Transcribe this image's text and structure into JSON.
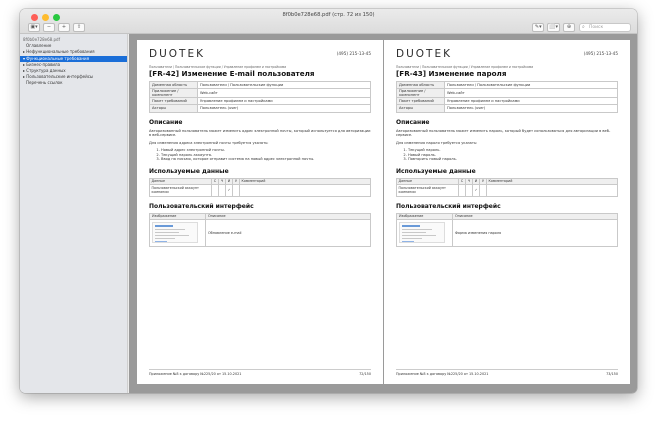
{
  "window": {
    "title": "8f0b0e728e68.pdf (стр. 72 из 150)",
    "search_placeholder": "Поиск",
    "toolbar_left": [
      "▣▾",
      "−",
      "+",
      "⇧"
    ],
    "toolbar_right": [
      "✎▾",
      "⬜▾",
      "⊕"
    ]
  },
  "sidebar": {
    "items": [
      {
        "label": "8f0b0e728e68.pdf",
        "level": "root"
      },
      {
        "label": "Оглавление",
        "level": 1
      },
      {
        "label": "▸ Нефункциональные требования",
        "level": 0
      },
      {
        "label": "▾ Функциональные требования",
        "level": 0,
        "selected": true
      },
      {
        "label": "▸ Бизнес-правила",
        "level": 0
      },
      {
        "label": "▸ Структура данных",
        "level": 0
      },
      {
        "label": "▸ Пользовательские интерфейсы",
        "level": 0
      },
      {
        "label": "Перечень ссылок",
        "level": 1
      }
    ]
  },
  "pages": [
    {
      "logo": "DUOTEK",
      "phone": "(495) 215-13-45",
      "breadcrumbs": "Пользователи / Пользовательские функции / Управление профилем и настройками",
      "title": "[FR-42] Изменение E-mail пользователя",
      "meta": [
        {
          "k": "Доменная область",
          "v": "Пользователи / Пользовательские функции"
        },
        {
          "k": "Приложение / компонент",
          "v": "Web-сайт"
        },
        {
          "k": "Пакет требований",
          "v": "Управление профилем и настройками"
        },
        {
          "k": "Акторы",
          "v": "Пользователь (user)"
        }
      ],
      "desc_heading": "Описание",
      "desc_p1": "Авторизованный пользователь может изменить адрес электронной почты, который используется для авторизации в веб-сервисе.",
      "desc_p2": "Для изменения адреса электронной почты требуется указать:",
      "steps": [
        "Новый адрес электронной почты.",
        "Текущий пароль аккаунта.",
        "Ввод на письмо, которое отправит система на новый адрес электронной почты."
      ],
      "data_heading": "Используемые данные",
      "data_cols": {
        "name": "Данные",
        "c": "С",
        "r": "Ч",
        "u": "И",
        "d": "У",
        "comment": "Комментарий"
      },
      "data_row": {
        "name": "Пользовательский аккаунт компании",
        "c": "",
        "r": "",
        "u": "✓",
        "d": "",
        "comment": ""
      },
      "ui_heading": "Пользовательский интерфейс",
      "ui_cols": {
        "img": "Изображение",
        "desc": "Описание"
      },
      "ui_row_desc": "Обновление e-mail",
      "footer_left": "Приложение №8 к договору №225/20 от 15.10.2021",
      "footer_right": "72/150"
    },
    {
      "logo": "DUOTEK",
      "phone": "(495) 215-13-45",
      "breadcrumbs": "Пользователи / Пользовательские функции / Управление профилем и настройками",
      "title": "[FR-43] Изменение пароля",
      "meta": [
        {
          "k": "Доменная область",
          "v": "Пользователи / Пользовательские функции"
        },
        {
          "k": "Приложение / компонент",
          "v": "Web-сайт"
        },
        {
          "k": "Пакет требований",
          "v": "Управление профилем и настройками"
        },
        {
          "k": "Акторы",
          "v": "Пользователь (user)"
        }
      ],
      "desc_heading": "Описание",
      "desc_p1": "Авторизованный пользователь может изменить пароль, который будет использоваться для авторизации в веб-сервисе.",
      "desc_p2": "Для изменения пароля требуется указать:",
      "steps": [
        "Текущий пароль.",
        "Новый пароль.",
        "Повторить новый пароль."
      ],
      "data_heading": "Используемые данные",
      "data_cols": {
        "name": "Данные",
        "c": "С",
        "r": "Ч",
        "u": "И",
        "d": "У",
        "comment": "Комментарий"
      },
      "data_row": {
        "name": "Пользовательский аккаунт компании",
        "c": "",
        "r": "",
        "u": "✓",
        "d": "",
        "comment": ""
      },
      "ui_heading": "Пользовательский интерфейс",
      "ui_cols": {
        "img": "Изображение",
        "desc": "Описание"
      },
      "ui_row_desc": "Форма изменения пароля",
      "footer_left": "Приложение №8 к договору №225/20 от 15.10.2021",
      "footer_right": "73/150"
    }
  ]
}
